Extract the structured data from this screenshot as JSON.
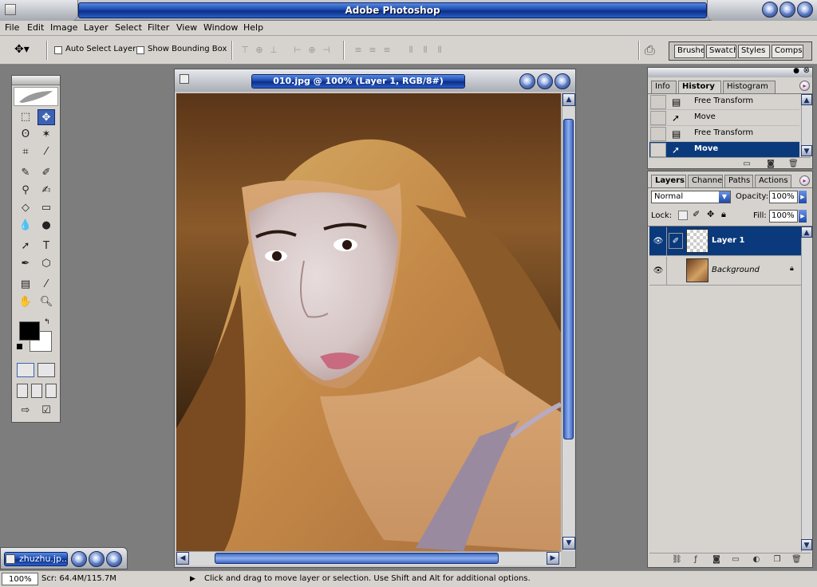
{
  "app": {
    "title": "Adobe Photoshop"
  },
  "menu": [
    "File",
    "Edit",
    "Image",
    "Layer",
    "Select",
    "Filter",
    "View",
    "Window",
    "Help"
  ],
  "options": {
    "auto_select": "Auto Select Layer",
    "bounding_box": "Show Bounding Box",
    "well_tabs": [
      "Brushes",
      "Swatch",
      "Styles",
      "Comps"
    ]
  },
  "document": {
    "title": "010.jpg @ 100% (Layer 1, RGB/8#)"
  },
  "history": {
    "tabs": [
      "Info",
      "History",
      "Histogram"
    ],
    "items": [
      {
        "label": "Free Transform",
        "icon": "free-transform-icon"
      },
      {
        "label": "Move",
        "icon": "move-icon"
      },
      {
        "label": "Free Transform",
        "icon": "free-transform-icon"
      },
      {
        "label": "Move",
        "icon": "move-icon"
      }
    ]
  },
  "layers": {
    "tabs": [
      "Layers",
      "Channels",
      "Paths",
      "Actions"
    ],
    "blend_mode": "Normal",
    "opacity_label": "Opacity:",
    "opacity": "100%",
    "lock_label": "Lock:",
    "fill_label": "Fill:",
    "fill": "100%",
    "items": [
      {
        "name": "Layer 1"
      },
      {
        "name": "Background"
      }
    ]
  },
  "minimized_doc": {
    "title": "zhuzhu.jp..."
  },
  "status": {
    "zoom": "100%",
    "scratch": "Scr: 64.4M/115.7M",
    "message": "Click and drag to move layer or selection.  Use Shift and Alt for additional options."
  },
  "colors": {
    "accent": "#0a3a7c",
    "title_blue": "#1a4ab0",
    "chrome": "#d6d3ce"
  }
}
